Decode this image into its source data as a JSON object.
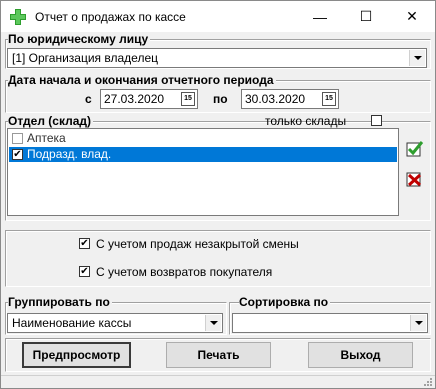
{
  "window": {
    "title": "Отчет о продажах по кассе",
    "minimize_glyph": "—",
    "maximize_glyph": "☐",
    "close_glyph": "✕"
  },
  "legal_entity": {
    "label": "По юридическому лицу",
    "value": "[1] Организация владелец"
  },
  "period": {
    "label": "Дата начала и окончания отчетного периода",
    "from_label": "с",
    "from_value": "27.03.2020",
    "to_label": "по",
    "to_value": "30.03.2020",
    "calendar_glyph": "15"
  },
  "department": {
    "label": "Отдел (склад)",
    "only_warehouses_label": "только склады",
    "only_warehouses_checked": false,
    "items": [
      {
        "label": "Аптека",
        "checked": false,
        "selected": false
      },
      {
        "label": "Подразд. влад.",
        "checked": true,
        "selected": true
      }
    ],
    "check_all_icon": "green-check-icon",
    "uncheck_all_icon": "red-cross-icon"
  },
  "options": {
    "unclosed_shift_label": "С учетом продаж незакрытой смены",
    "unclosed_shift_checked": true,
    "returns_label": "С учетом возвратов покупателя",
    "returns_checked": true
  },
  "grouping": {
    "label": "Группировать по",
    "value": "Наименование кассы"
  },
  "sorting": {
    "label": "Сортировка по",
    "value": ""
  },
  "buttons": {
    "preview": "Предпросмотр",
    "print": "Печать",
    "exit": "Выход"
  },
  "colors": {
    "selection": "#0078d7",
    "accent_green": "#2e9e2e",
    "accent_red": "#c00000"
  }
}
